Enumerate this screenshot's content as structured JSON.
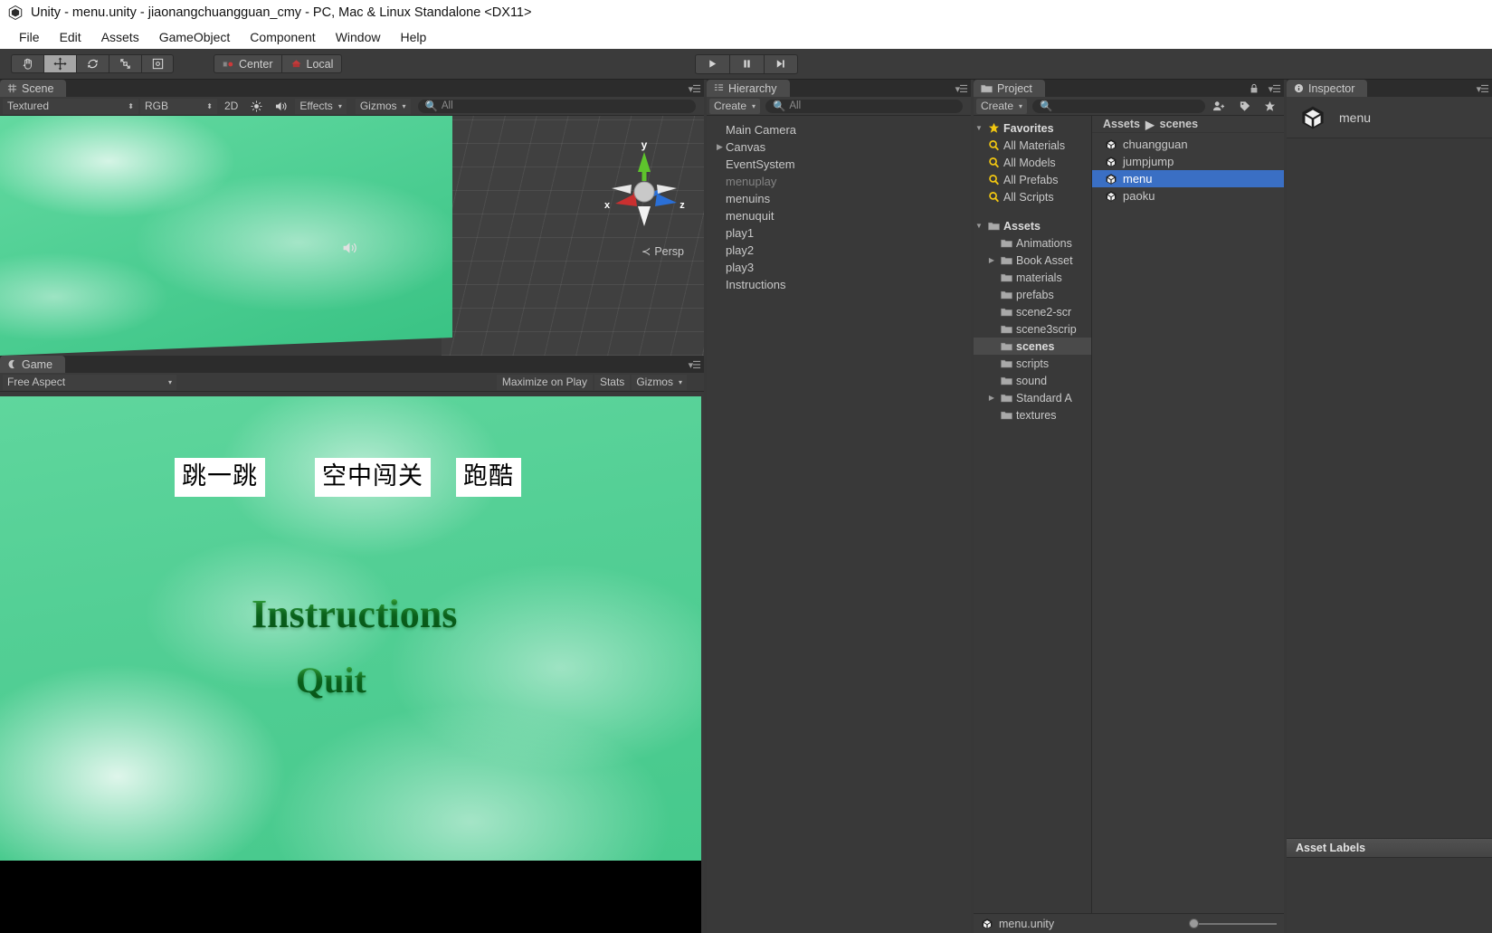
{
  "window": {
    "title": "Unity - menu.unity - jiaonangchuangguan_cmy - PC, Mac & Linux Standalone <DX11>",
    "app_icon": "unity-logo-icon"
  },
  "menubar": {
    "items": [
      "File",
      "Edit",
      "Assets",
      "GameObject",
      "Component",
      "Window",
      "Help"
    ]
  },
  "toolbar": {
    "tools": [
      {
        "name": "hand-tool",
        "icon": "hand-icon",
        "active": false
      },
      {
        "name": "move-tool",
        "icon": "move-icon",
        "active": true
      },
      {
        "name": "rotate-tool",
        "icon": "rotate-icon",
        "active": false
      },
      {
        "name": "scale-tool",
        "icon": "scale-icon",
        "active": false
      },
      {
        "name": "rect-tool",
        "icon": "rect-transform-icon",
        "active": false
      }
    ],
    "pivot_label": "Center",
    "rotation_label": "Local",
    "play_label": "play-icon",
    "pause_label": "pause-icon",
    "step_label": "step-icon"
  },
  "scene": {
    "tab_label": "Scene",
    "draw_mode": "Textured",
    "render_mode": "RGB",
    "two_d": "2D",
    "lighting_icon": "sun-icon",
    "audio_icon": "audio-icon",
    "effects": "Effects",
    "gizmos": "Gizmos",
    "search_placeholder": "All",
    "search_value": "",
    "gizmo": {
      "x_label": "x",
      "y_label": "y",
      "z_label": "z",
      "projection": "Persp",
      "x_color": "#c93030",
      "y_color": "#5ec42c",
      "z_color": "#2a6fd6"
    }
  },
  "game": {
    "tab_label": "Game",
    "aspect": "Free Aspect",
    "maximize_on_play": "Maximize on Play",
    "stats": "Stats",
    "gizmos": "Gizmos",
    "content": {
      "buttons": [
        {
          "label": "跳一跳",
          "name": "play1-button"
        },
        {
          "label": "空中闯关",
          "name": "play2-button"
        },
        {
          "label": "跑酷",
          "name": "play3-button"
        }
      ],
      "instructions_label": "Instructions",
      "quit_label": "Quit",
      "background_color": "#4fcf94"
    }
  },
  "hierarchy": {
    "tab_label": "Hierarchy",
    "create_label": "Create",
    "search_placeholder": "All",
    "search_value": "",
    "items": [
      {
        "label": "Main Camera",
        "expandable": false,
        "dim": false
      },
      {
        "label": "Canvas",
        "expandable": true,
        "dim": false
      },
      {
        "label": "EventSystem",
        "expandable": false,
        "dim": false
      },
      {
        "label": "menuplay",
        "expandable": false,
        "dim": true
      },
      {
        "label": "menuins",
        "expandable": false,
        "dim": false
      },
      {
        "label": "menuquit",
        "expandable": false,
        "dim": false
      },
      {
        "label": "play1",
        "expandable": false,
        "dim": false
      },
      {
        "label": "play2",
        "expandable": false,
        "dim": false
      },
      {
        "label": "play3",
        "expandable": false,
        "dim": false
      },
      {
        "label": "Instructions",
        "expandable": false,
        "dim": false
      }
    ]
  },
  "project": {
    "tab_label": "Project",
    "create_label": "Create",
    "search_placeholder": "",
    "search_value": "",
    "lock_icon": "lock-icon",
    "favorites": {
      "label": "Favorites",
      "items": [
        "All Materials",
        "All Models",
        "All Prefabs",
        "All Scripts"
      ]
    },
    "assets": {
      "label": "Assets",
      "items": [
        {
          "label": "Animations",
          "expandable": false,
          "selected": false
        },
        {
          "label": "Book Asset",
          "expandable": true,
          "selected": false
        },
        {
          "label": "materials",
          "expandable": false,
          "selected": false
        },
        {
          "label": "prefabs",
          "expandable": false,
          "selected": false
        },
        {
          "label": "scene2-scr",
          "expandable": false,
          "selected": false
        },
        {
          "label": "scene3scrip",
          "expandable": false,
          "selected": false
        },
        {
          "label": "scenes",
          "expandable": false,
          "selected": true
        },
        {
          "label": "scripts",
          "expandable": false,
          "selected": false
        },
        {
          "label": "sound",
          "expandable": false,
          "selected": false
        },
        {
          "label": "Standard A",
          "expandable": true,
          "selected": false
        },
        {
          "label": "textures",
          "expandable": false,
          "selected": false
        }
      ]
    },
    "breadcrumb": [
      "Assets",
      "scenes"
    ],
    "files": [
      {
        "label": "chuangguan",
        "selected": false
      },
      {
        "label": "jumpjump",
        "selected": false
      },
      {
        "label": "menu",
        "selected": true
      },
      {
        "label": "paoku",
        "selected": false
      }
    ],
    "footer_label": "menu.unity",
    "selection_color": "#3a6fc4"
  },
  "inspector": {
    "tab_label": "Inspector",
    "asset_name": "menu",
    "asset_labels_label": "Asset Labels"
  }
}
